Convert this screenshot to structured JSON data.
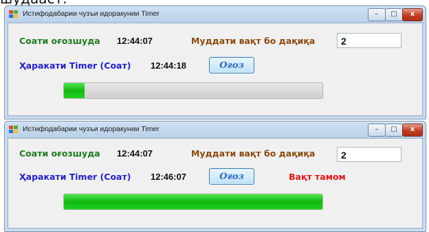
{
  "top_caption": "шудааст.",
  "windows": [
    {
      "title": "Истифодабарии чузъи идоракунии Timer",
      "controls": {
        "minimize": "–",
        "maximize": "□",
        "close": "x"
      },
      "row1": {
        "label_current": "Соати оғозшуда",
        "current_time": "12:44:07",
        "label_duration": "Муддати вақт бо дақиқа",
        "duration_value": "2"
      },
      "row2": {
        "label_timer": "Ҳаракати Timer (Соат)",
        "timer_time": "12:44:18",
        "start_button": "Оғоз",
        "status": ""
      },
      "progress": 0.08
    },
    {
      "title": "Истифодабарии чузъи идоракунии Timer",
      "controls": {
        "minimize": "–",
        "maximize": "□",
        "close": "x"
      },
      "row1": {
        "label_current": "Соати оғозшуда",
        "current_time": "12:44:07",
        "label_duration": "Муддати вақт бо дақиқа",
        "duration_value": "2"
      },
      "row2": {
        "label_timer": "Ҳаракати Timer (Соат)",
        "timer_time": "12:46:07",
        "start_button": "Оғоз",
        "status": "Вақт тамом"
      },
      "progress": 1.0
    }
  ]
}
